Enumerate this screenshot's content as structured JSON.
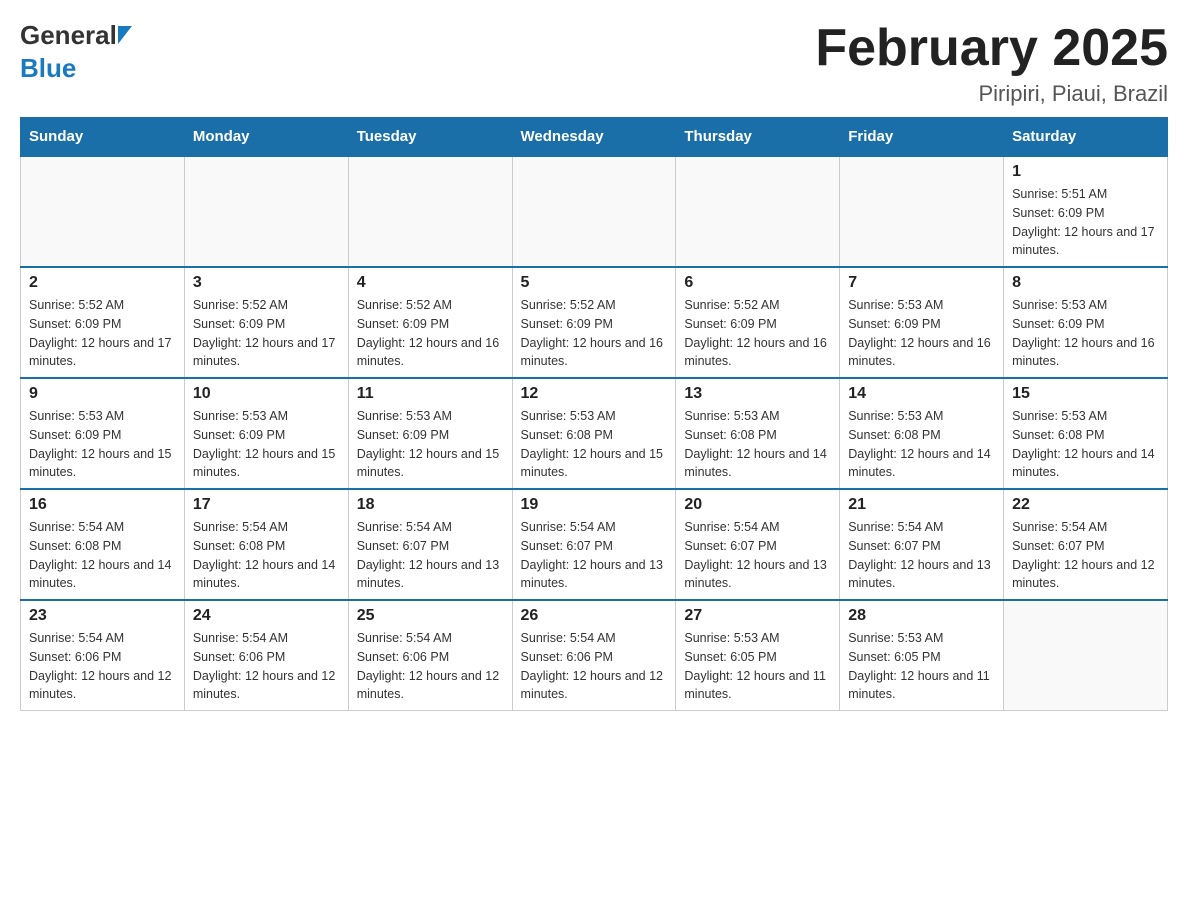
{
  "header": {
    "month_title": "February 2025",
    "location": "Piripiri, Piaui, Brazil",
    "logo_general": "General",
    "logo_blue": "Blue"
  },
  "days_of_week": [
    "Sunday",
    "Monday",
    "Tuesday",
    "Wednesday",
    "Thursday",
    "Friday",
    "Saturday"
  ],
  "weeks": [
    {
      "days": [
        {
          "number": "",
          "info": ""
        },
        {
          "number": "",
          "info": ""
        },
        {
          "number": "",
          "info": ""
        },
        {
          "number": "",
          "info": ""
        },
        {
          "number": "",
          "info": ""
        },
        {
          "number": "",
          "info": ""
        },
        {
          "number": "1",
          "info": "Sunrise: 5:51 AM\nSunset: 6:09 PM\nDaylight: 12 hours and 17 minutes."
        }
      ]
    },
    {
      "days": [
        {
          "number": "2",
          "info": "Sunrise: 5:52 AM\nSunset: 6:09 PM\nDaylight: 12 hours and 17 minutes."
        },
        {
          "number": "3",
          "info": "Sunrise: 5:52 AM\nSunset: 6:09 PM\nDaylight: 12 hours and 17 minutes."
        },
        {
          "number": "4",
          "info": "Sunrise: 5:52 AM\nSunset: 6:09 PM\nDaylight: 12 hours and 16 minutes."
        },
        {
          "number": "5",
          "info": "Sunrise: 5:52 AM\nSunset: 6:09 PM\nDaylight: 12 hours and 16 minutes."
        },
        {
          "number": "6",
          "info": "Sunrise: 5:52 AM\nSunset: 6:09 PM\nDaylight: 12 hours and 16 minutes."
        },
        {
          "number": "7",
          "info": "Sunrise: 5:53 AM\nSunset: 6:09 PM\nDaylight: 12 hours and 16 minutes."
        },
        {
          "number": "8",
          "info": "Sunrise: 5:53 AM\nSunset: 6:09 PM\nDaylight: 12 hours and 16 minutes."
        }
      ]
    },
    {
      "days": [
        {
          "number": "9",
          "info": "Sunrise: 5:53 AM\nSunset: 6:09 PM\nDaylight: 12 hours and 15 minutes."
        },
        {
          "number": "10",
          "info": "Sunrise: 5:53 AM\nSunset: 6:09 PM\nDaylight: 12 hours and 15 minutes."
        },
        {
          "number": "11",
          "info": "Sunrise: 5:53 AM\nSunset: 6:09 PM\nDaylight: 12 hours and 15 minutes."
        },
        {
          "number": "12",
          "info": "Sunrise: 5:53 AM\nSunset: 6:08 PM\nDaylight: 12 hours and 15 minutes."
        },
        {
          "number": "13",
          "info": "Sunrise: 5:53 AM\nSunset: 6:08 PM\nDaylight: 12 hours and 14 minutes."
        },
        {
          "number": "14",
          "info": "Sunrise: 5:53 AM\nSunset: 6:08 PM\nDaylight: 12 hours and 14 minutes."
        },
        {
          "number": "15",
          "info": "Sunrise: 5:53 AM\nSunset: 6:08 PM\nDaylight: 12 hours and 14 minutes."
        }
      ]
    },
    {
      "days": [
        {
          "number": "16",
          "info": "Sunrise: 5:54 AM\nSunset: 6:08 PM\nDaylight: 12 hours and 14 minutes."
        },
        {
          "number": "17",
          "info": "Sunrise: 5:54 AM\nSunset: 6:08 PM\nDaylight: 12 hours and 14 minutes."
        },
        {
          "number": "18",
          "info": "Sunrise: 5:54 AM\nSunset: 6:07 PM\nDaylight: 12 hours and 13 minutes."
        },
        {
          "number": "19",
          "info": "Sunrise: 5:54 AM\nSunset: 6:07 PM\nDaylight: 12 hours and 13 minutes."
        },
        {
          "number": "20",
          "info": "Sunrise: 5:54 AM\nSunset: 6:07 PM\nDaylight: 12 hours and 13 minutes."
        },
        {
          "number": "21",
          "info": "Sunrise: 5:54 AM\nSunset: 6:07 PM\nDaylight: 12 hours and 13 minutes."
        },
        {
          "number": "22",
          "info": "Sunrise: 5:54 AM\nSunset: 6:07 PM\nDaylight: 12 hours and 12 minutes."
        }
      ]
    },
    {
      "days": [
        {
          "number": "23",
          "info": "Sunrise: 5:54 AM\nSunset: 6:06 PM\nDaylight: 12 hours and 12 minutes."
        },
        {
          "number": "24",
          "info": "Sunrise: 5:54 AM\nSunset: 6:06 PM\nDaylight: 12 hours and 12 minutes."
        },
        {
          "number": "25",
          "info": "Sunrise: 5:54 AM\nSunset: 6:06 PM\nDaylight: 12 hours and 12 minutes."
        },
        {
          "number": "26",
          "info": "Sunrise: 5:54 AM\nSunset: 6:06 PM\nDaylight: 12 hours and 12 minutes."
        },
        {
          "number": "27",
          "info": "Sunrise: 5:53 AM\nSunset: 6:05 PM\nDaylight: 12 hours and 11 minutes."
        },
        {
          "number": "28",
          "info": "Sunrise: 5:53 AM\nSunset: 6:05 PM\nDaylight: 12 hours and 11 minutes."
        },
        {
          "number": "",
          "info": ""
        }
      ]
    }
  ]
}
